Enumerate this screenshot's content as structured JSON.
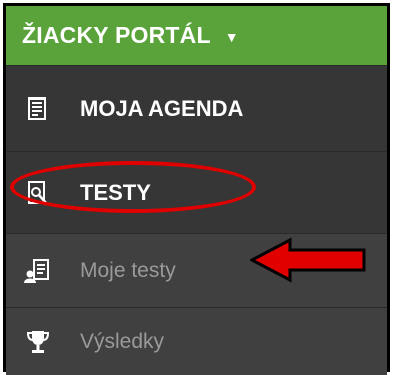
{
  "header": {
    "title": "ŽIACKY PORTÁL",
    "caret_icon": "chevron-down-icon",
    "bg_color": "#5aa33b"
  },
  "items": [
    {
      "label": "MOJA AGENDA",
      "icon": "agenda-icon",
      "type": "section"
    },
    {
      "label": "TESTY",
      "icon": "test-icon",
      "type": "section"
    },
    {
      "label": "Moje testy",
      "icon": "my-tests-icon",
      "type": "sub"
    },
    {
      "label": "Výsledky",
      "icon": "trophy-icon",
      "type": "sub"
    }
  ],
  "annotations": {
    "ellipse_color": "#e00000",
    "arrow_color": "#e00000"
  }
}
